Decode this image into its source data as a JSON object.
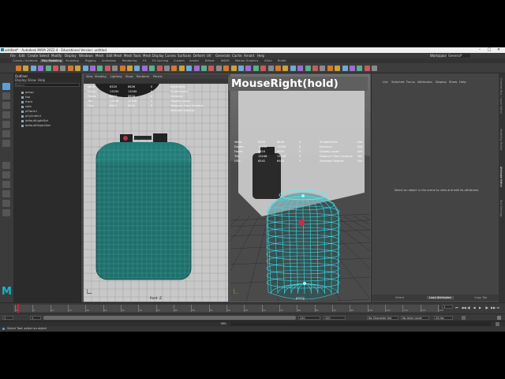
{
  "window": {
    "title": "untitled* - Autodesk MAYA 2022.4 - Educational Version: untitled",
    "controls": [
      "–",
      "□",
      "✕"
    ]
  },
  "menubar": {
    "items": [
      "File",
      "Edit",
      "Create",
      "Select",
      "Modify",
      "Display",
      "Windows",
      "Mesh",
      "Edit Mesh",
      "Mesh Tools",
      "Mesh Display",
      "Curves",
      "Surfaces",
      "Deform",
      "UV",
      "Generate",
      "Cache",
      "Arnold",
      "Help"
    ],
    "workspace_label": "Workspace :",
    "workspace_value": "General*"
  },
  "shelf_tabs": {
    "items": [
      "Curves / Surfaces",
      "Poly Modeling",
      "Sculpting",
      "Rigging",
      "Animation",
      "Rendering",
      "FX",
      "FX Caching",
      "Custom",
      "Arnold",
      "Bifrost",
      "MASH",
      "Motion Graphics",
      "XGen",
      "Bullet"
    ],
    "active": "Poly Modeling"
  },
  "shelf_icons": [
    "sphere-icon",
    "cube-icon",
    "cylinder-icon",
    "cone-icon",
    "torus-icon",
    "plane-icon",
    "disc-icon",
    "platonic-icon",
    "pipe-icon",
    "helix-icon",
    "soccer-icon",
    "super-shape-icon",
    "text-icon",
    "svg-icon",
    "combine-icon",
    "separate-icon",
    "smooth-icon",
    "boolean-icon",
    "mirror-icon",
    "extrude-icon",
    "bridge-icon",
    "bevel-icon",
    "fill-hole-icon",
    "merge-icon",
    "multicut-icon",
    "target-weld-icon",
    "quad-draw-icon",
    "uv-editor-icon",
    "planar-map-icon",
    "auto-map-icon",
    "cut-uv-icon",
    "sew-uv-icon",
    "unfold-icon",
    "layout-icon",
    "center-pivot-icon",
    "freeze-icon",
    "delete-history-icon",
    "grid-icon",
    "snap-curve-icon",
    "snap-point-icon",
    "snap-view-icon",
    "snap-live-icon",
    "magnet-icon",
    "symmetry-icon",
    "render-icon",
    "ipr-icon",
    "render-settings-icon",
    "hypershade-icon",
    "arnold-render-icon"
  ],
  "outliner": {
    "title": "Outliner",
    "menu": [
      "Display",
      "Show",
      "Help"
    ],
    "search_placeholder": "Search...",
    "items": [
      "persp",
      "top",
      "front",
      "side",
      "pPlane1",
      "pCylinder1",
      "defaultLightSet",
      "defaultObjectSet"
    ]
  },
  "viewport_left": {
    "menu": [
      "View",
      "Shading",
      "Lighting",
      "Show",
      "Renderer",
      "Panels"
    ],
    "label": "front -Z",
    "hud": {
      "rows": [
        [
          "Verts:",
          "6320",
          "6626",
          "0"
        ],
        [
          "Edges:",
          "13250",
          "13240",
          "0"
        ],
        [
          "Faces:",
          "6624",
          "6624",
          "0"
        ],
        [
          "Tris:",
          "13248",
          "13248",
          "0"
        ],
        [
          "UVs:",
          "6541",
          "6943",
          "0"
        ]
      ],
      "right": [
        "Backfaces:",
        "Smoothness:",
        "Instance:",
        "Display Layer:",
        "Distance From Camera:",
        "Selected Objects:"
      ]
    }
  },
  "viewport_right": {
    "label": "persp",
    "hud": {
      "rows": [
        [
          "Verts:",
          "6320",
          "6626",
          "0"
        ],
        [
          "Edges:",
          "13250",
          "13240",
          "0"
        ],
        [
          "Faces:",
          "6624",
          "6624",
          "0"
        ],
        [
          "Tris:",
          "13248",
          "13248",
          "0"
        ],
        [
          "UVs:",
          "6541",
          "6943",
          "0"
        ]
      ],
      "right": [
        "Smoothness:",
        "Instance:",
        "Display Layer:",
        "Distance From Camera:",
        "Selected Objects:"
      ],
      "right_vals": [
        "N/A",
        "N/A",
        "N/A",
        "N/A",
        "N/A"
      ]
    }
  },
  "overlay_text": "MouseRight(hold)",
  "attribute_editor": {
    "menu": [
      "List",
      "Selected",
      "Focus",
      "Attributes",
      "Display",
      "Show",
      "Help"
    ],
    "message": "Select an object in the scene to view and edit its attributes.",
    "tabs": [
      "Select",
      "Load Attributes",
      "Copy Tab"
    ],
    "active_tab": "Load Attributes"
  },
  "side_tabs": [
    "Channel Box / Layer Editor",
    "Modeling Toolkit",
    "Attribute Editor",
    "Tool Settings"
  ],
  "timeslider": {
    "ticks": [
      "1",
      "5",
      "10",
      "15",
      "20",
      "25",
      "30",
      "35",
      "40",
      "45",
      "50",
      "55",
      "60",
      "65",
      "70",
      "75",
      "80",
      "85",
      "90",
      "95",
      "100",
      "105",
      "110",
      "115",
      "120"
    ],
    "current_frame": "1",
    "playback_buttons": [
      "⏮",
      "◀◀",
      "◀|",
      "◀",
      "▶",
      "|▶",
      "▶▶",
      "⏭"
    ]
  },
  "range": {
    "start": "1",
    "inner_start": "1",
    "inner_end": "120",
    "end": "120",
    "end2": "200",
    "character_set": "No Character Set",
    "anim_layer": "No Anim Layer",
    "fps": "24 fps"
  },
  "cmdline": {
    "lang": "MEL"
  },
  "helpline": {
    "text": "Select Tool: select an object"
  },
  "colors": {
    "accent": "#5aa0d6",
    "mesh_teal": "#1f6f6c",
    "wire_cyan": "#35e0e8"
  }
}
